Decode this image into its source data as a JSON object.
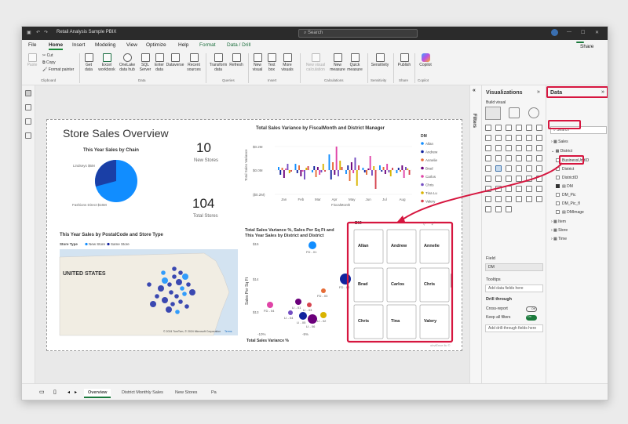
{
  "title": "Retail Analysis Sample PBIX",
  "search": "Search",
  "share": "Share",
  "menu": [
    "File",
    "Home",
    "Insert",
    "Modeling",
    "View",
    "Optimize",
    "Help",
    "Format",
    "Data / Drill"
  ],
  "ribbon": {
    "clipboard": {
      "paste": "Paste",
      "cut": "Cut",
      "copy": "Copy",
      "format_painter": "Format painter",
      "group": "Clipboard"
    },
    "data_buttons": [
      "Get data",
      "Excel workbook",
      "OneLake data hub",
      "SQL Server",
      "Enter data",
      "Dataverse",
      "Recent sources"
    ],
    "data_group": "Data",
    "queries": [
      "Transform data",
      "Refresh"
    ],
    "queries_group": "Queries",
    "insert": [
      "New visual",
      "Text box",
      "More visuals"
    ],
    "insert_group": "Insert",
    "calc": [
      "New visual calculation",
      "New measure",
      "Quick measure"
    ],
    "calc_group": "Calculations",
    "sens": "Sensitivity",
    "sens_group": "Sensitivity",
    "publish": "Publish",
    "share_group": "Share",
    "copilot": "Copilot",
    "copilot_group": "Copilot"
  },
  "report": {
    "title": "Store Sales Overview",
    "pie_title": "This Year Sales by Chain",
    "pie_labels": [
      "Lindseys $6M",
      "Fashions Direct $16M"
    ],
    "kpi1": {
      "value": "10",
      "label": "New Stores"
    },
    "kpi2": {
      "value": "104",
      "label": "Total Stores"
    },
    "var_title": "Total Sales Variance by FiscalMonth and District Manager",
    "var_ylabel": "Total Sales Variance",
    "var_xlabel": "FiscalMonth",
    "var_yticks": [
      "$0.2M",
      "$0.0M",
      "($0.2M)"
    ],
    "var_xticks": [
      "Jan",
      "Feb",
      "Mar",
      "Apr",
      "May",
      "Jun",
      "Jul",
      "Aug"
    ],
    "map_title": "This Year Sales by PostalCode and Store Type",
    "map_legend": [
      "Store Type",
      "New Store",
      "Same Store"
    ],
    "map_country": "UNITED STATES",
    "map_credit": "© 2024 TomTom, © 2024 Microsoft Corporation",
    "map_terms": "Terms",
    "scatter_title": "Total Sales Variance %, Sales Per Sq Ft and This Year Sales by District and District",
    "scatter_ylabel": "Sales Per Sq Ft",
    "scatter_xlabel": "Total Sales Variance %",
    "scatter_yticks": [
      "$15",
      "$14",
      "$13"
    ],
    "scatter_xticks": [
      "-10%",
      "-5%"
    ],
    "scatter_labels": [
      "FD - 01",
      "FD - 02",
      "FD - 03",
      "FD - 04",
      "LI - 01",
      "LI - 03",
      "LI - 04",
      "LI - 05",
      "LI - 06",
      "LI - 02"
    ],
    "slicer_title": "DM",
    "slicer_items": [
      "Allan",
      "Andrew",
      "Annelie",
      "Brad",
      "Carlos",
      "Chris",
      "Chris",
      "Tina",
      "Valery"
    ],
    "dm_legend_title": "DM",
    "dm_legend": [
      "Allan",
      "Andrew",
      "Annelie",
      "Brad",
      "Carlos",
      "Chris",
      "Tina Lu",
      "Valery"
    ],
    "watermark": "obviEnce llc ©"
  },
  "filters": "Filters",
  "vis": {
    "title": "Visualizations",
    "build": "Build visual",
    "field": "Field",
    "field_value": "DM",
    "tooltips": "Tooltips",
    "add_tooltip": "Add data fields here",
    "drill": "Drill through",
    "cross": "Cross-report",
    "cross_state": "Off",
    "keep": "Keep all filters",
    "keep_state": "On",
    "add_drill": "Add drill-through fields here"
  },
  "datap": {
    "title": "Data",
    "search": "Search",
    "tables": [
      "Sales",
      "District",
      "Item",
      "Store",
      "Time"
    ],
    "district_fields": [
      "BusinessUnitID",
      "District",
      "DistrictID",
      "DM",
      "DM_Pic",
      "DM_Pic_fl",
      "DMImage"
    ]
  },
  "pages": [
    "Overview",
    "District Monthly Sales",
    "New Stores",
    "Pa"
  ]
}
